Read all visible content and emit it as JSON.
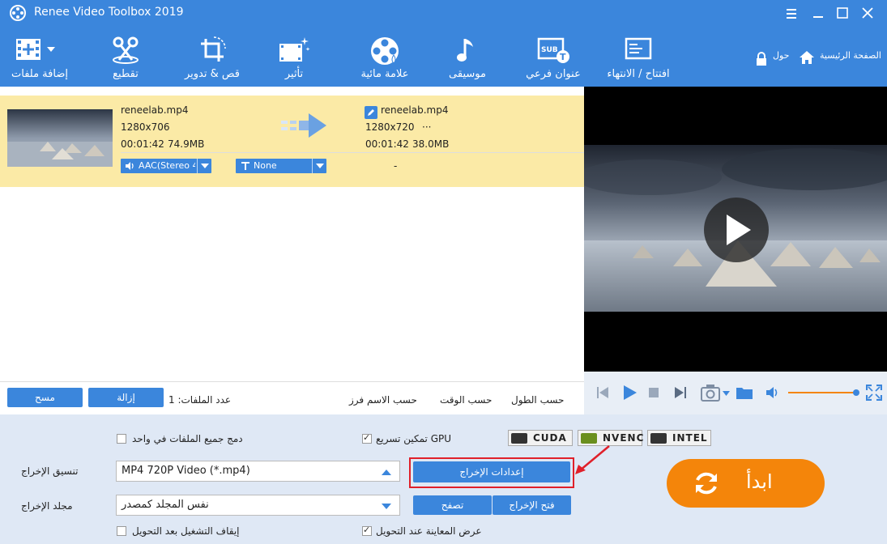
{
  "window": {
    "title": "Renee Video Toolbox 2019"
  },
  "toolbar": {
    "items": [
      {
        "label": "إضافة ملفات",
        "icon": "add-files-icon"
      },
      {
        "label": "تقطيع",
        "icon": "scissors-icon"
      },
      {
        "label": "قص & تدوير",
        "icon": "crop-rotate-icon"
      },
      {
        "label": "تأثير",
        "icon": "effect-icon"
      },
      {
        "label": "علامة مائية",
        "icon": "watermark-icon"
      },
      {
        "label": "موسيقى",
        "icon": "music-icon"
      },
      {
        "label": "عنوان فرعي",
        "icon": "subtitle-icon"
      },
      {
        "label": "افتتاح / الانتهاء",
        "icon": "opening-ending-icon"
      }
    ],
    "about_label": "حول",
    "home_label": "الصفحة الرئيسية"
  },
  "file": {
    "source": {
      "name": "reneelab.mp4",
      "resolution": "1280x706",
      "duration": "00:01:42",
      "size": "74.9MB"
    },
    "output": {
      "name": "reneelab.mp4",
      "resolution": "1280x720",
      "more": "···",
      "duration": "00:01:42",
      "size": "38.0MB"
    },
    "audio_track": "AAC(Stereo 4",
    "subtitle_track": "None",
    "dash": "-"
  },
  "list_controls": {
    "clear_label": "مسح",
    "remove_label": "إزالة",
    "file_count_label": "عدد الملفات: 1",
    "sort_by_name": "حسب الاسم فرز",
    "sort_by_time": "حسب الوقت",
    "sort_by_length": "حسب الطول"
  },
  "settings": {
    "merge_all_label": "دمج جميع الملفات في واحد",
    "merge_all_checked": false,
    "gpu_label": "تمكين تسريع GPU",
    "gpu_checked": true,
    "accel": [
      "CUDA",
      "NVENC",
      "INTEL"
    ],
    "output_format_label": "تنسيق الإخراج",
    "output_format_value": "MP4 720P Video (*.mp4)",
    "output_settings_label": "إعدادات الإخراج",
    "output_folder_label": "مجلد الإخراج",
    "output_folder_value": "نفس المجلد كمصدر",
    "browse_label": "تصفح",
    "open_output_label": "فتح الإخراج",
    "stop_after_label": "إيقاف التشغيل بعد التحويل",
    "stop_after_checked": false,
    "preview_label": "عرض المعاينة عند التحويل",
    "preview_checked": true,
    "start_label": "ابدأ"
  },
  "player": {
    "volume": 1.0
  },
  "colors": {
    "primary": "#3b86dc",
    "highlight_row": "#fbeaa6",
    "start": "#f4850a",
    "callout": "#e0202a"
  }
}
